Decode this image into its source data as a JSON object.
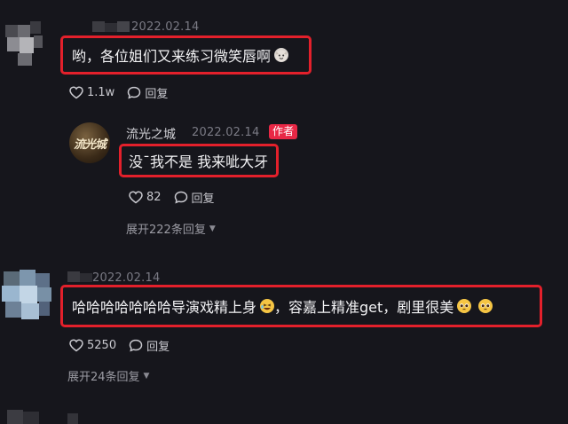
{
  "comments": [
    {
      "date": "2022.02.14",
      "text": "哟，各位姐们又来练习微笑唇啊",
      "emoji": "cat-emoji",
      "likes": "1.1w",
      "reply_label": "回复",
      "reply": {
        "author": "流光之城",
        "avatar_text": "流光城",
        "date": "2022.02.14",
        "tag": "作者",
        "text": "没¯我不是 我来呲大牙",
        "likes": "82",
        "reply_label": "回复",
        "expand_label": "展开222条回复"
      }
    },
    {
      "date": "2022.02.14",
      "text_part1": "哈哈哈哈哈哈哈导演戏精上身",
      "text_part2": "，容嘉上精准get，剧里很美",
      "emoji_1": "laughing-emoji",
      "emoji_2": "pleading-emoji",
      "likes": "5250",
      "reply_label": "回复",
      "expand_label": "展开24条回复"
    }
  ],
  "colors": {
    "background": "#16161c",
    "highlight_border": "#e3202b",
    "author_tag": "#e82745"
  }
}
